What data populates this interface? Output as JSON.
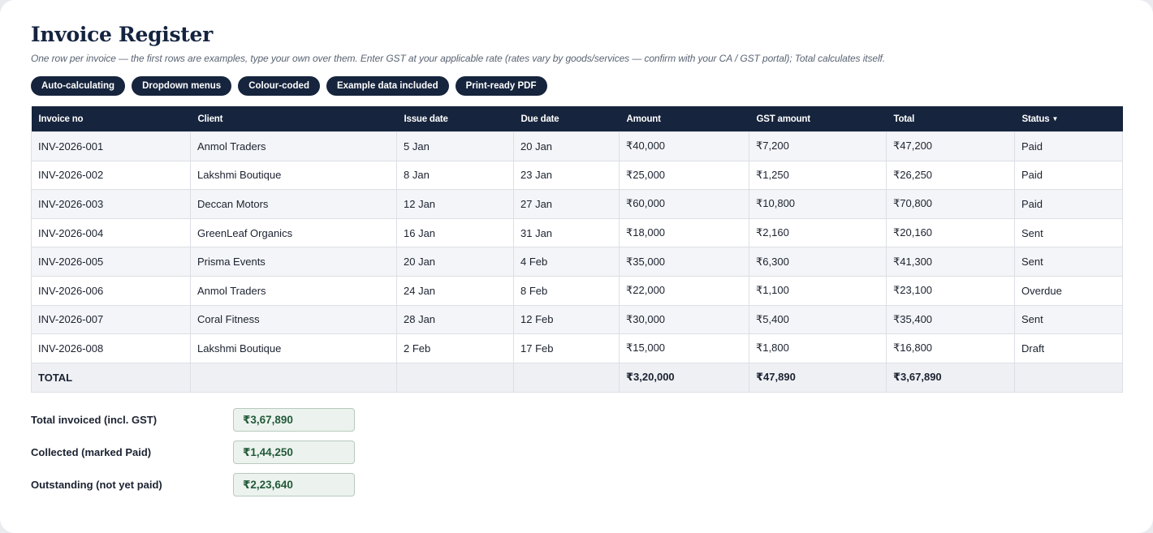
{
  "header": {
    "title": "Invoice Register",
    "subtitle": "One row per invoice — the first rows are examples, type your own over them. Enter GST at your applicable rate (rates vary by goods/services — confirm with your CA / GST portal); Total calculates itself."
  },
  "chips": [
    "Auto-calculating",
    "Dropdown menus",
    "Colour-coded",
    "Example data included",
    "Print-ready PDF"
  ],
  "table": {
    "columns": [
      "Invoice no",
      "Client",
      "Issue date",
      "Due date",
      "Amount",
      "GST amount",
      "Total",
      "Status"
    ],
    "status_dropdown_icon": "caret-down-icon",
    "rows": [
      [
        "INV-2026-001",
        "Anmol Traders",
        "5 Jan",
        "20 Jan",
        "₹40,000",
        "₹7,200",
        "₹47,200",
        "Paid"
      ],
      [
        "INV-2026-002",
        "Lakshmi Boutique",
        "8 Jan",
        "23 Jan",
        "₹25,000",
        "₹1,250",
        "₹26,250",
        "Paid"
      ],
      [
        "INV-2026-003",
        "Deccan Motors",
        "12 Jan",
        "27 Jan",
        "₹60,000",
        "₹10,800",
        "₹70,800",
        "Paid"
      ],
      [
        "INV-2026-004",
        "GreenLeaf Organics",
        "16 Jan",
        "31 Jan",
        "₹18,000",
        "₹2,160",
        "₹20,160",
        "Sent"
      ],
      [
        "INV-2026-005",
        "Prisma Events",
        "20 Jan",
        "4 Feb",
        "₹35,000",
        "₹6,300",
        "₹41,300",
        "Sent"
      ],
      [
        "INV-2026-006",
        "Anmol Traders",
        "24 Jan",
        "8 Feb",
        "₹22,000",
        "₹1,100",
        "₹23,100",
        "Overdue"
      ],
      [
        "INV-2026-007",
        "Coral Fitness",
        "28 Jan",
        "12 Feb",
        "₹30,000",
        "₹5,400",
        "₹35,400",
        "Sent"
      ],
      [
        "INV-2026-008",
        "Lakshmi Boutique",
        "2 Feb",
        "17 Feb",
        "₹15,000",
        "₹1,800",
        "₹16,800",
        "Draft"
      ]
    ],
    "total_row": {
      "label": "TOTAL",
      "amount": "₹3,20,000",
      "gst_amount": "₹47,890",
      "total": "₹3,67,890"
    }
  },
  "summary": [
    {
      "label": "Total invoiced (incl. GST)",
      "value": "₹3,67,890"
    },
    {
      "label": "Collected (marked Paid)",
      "value": "₹1,44,250"
    },
    {
      "label": "Outstanding (not yet paid)",
      "value": "₹2,23,640"
    }
  ],
  "colors": {
    "navy": "#16243d",
    "summary_fill": "#ecf3ee",
    "summary_text": "#23593a"
  }
}
